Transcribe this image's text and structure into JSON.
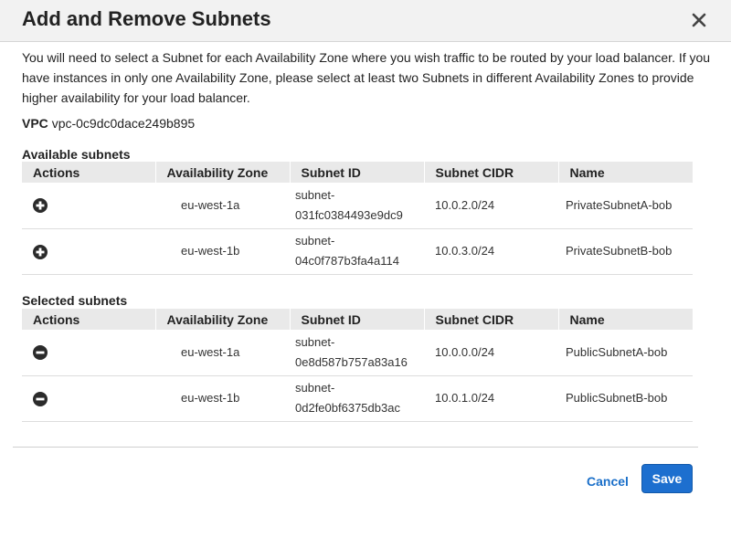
{
  "dialog": {
    "title": "Add and Remove Subnets",
    "close_icon": "close-icon",
    "intro": "You will need to select a Subnet for each Availability Zone where you wish traffic to be routed by your load balancer. If you have instances in only one Availability Zone, please select at least two Subnets in different Availability Zones to provide higher availability for your load balancer.",
    "vpc_label": "VPC",
    "vpc_value": "vpc-0c9dc0dace249b895"
  },
  "columns": [
    "Actions",
    "Availability Zone",
    "Subnet ID",
    "Subnet CIDR",
    "Name"
  ],
  "available": {
    "title": "Available subnets",
    "action_icon": "add-circle-icon",
    "rows": [
      {
        "az": "eu-west-1a",
        "subnet_id_line1": "subnet-",
        "subnet_id_line2": "031fc0384493e9dc9",
        "cidr": "10.0.2.0/24",
        "name": "PrivateSubnetA-bob"
      },
      {
        "az": "eu-west-1b",
        "subnet_id_line1": "subnet-",
        "subnet_id_line2": "04c0f787b3fa4a114",
        "cidr": "10.0.3.0/24",
        "name": "PrivateSubnetB-bob"
      }
    ]
  },
  "selected": {
    "title": "Selected subnets",
    "action_icon": "remove-circle-icon",
    "rows": [
      {
        "az": "eu-west-1a",
        "subnet_id_line1": "subnet-",
        "subnet_id_line2": "0e8d587b757a83a16",
        "cidr": "10.0.0.0/24",
        "name": "PublicSubnetA-bob"
      },
      {
        "az": "eu-west-1b",
        "subnet_id_line1": "subnet-",
        "subnet_id_line2": "0d2fe0bf6375db3ac",
        "cidr": "10.0.1.0/24",
        "name": "PublicSubnetB-bob"
      }
    ]
  },
  "footer": {
    "cancel_label": "Cancel",
    "save_label": "Save"
  },
  "colors": {
    "accent": "#1d6fcf",
    "link": "#1a6fc9",
    "header_bg": "#f2f2f2",
    "table_header_bg": "#e9e9e9"
  }
}
